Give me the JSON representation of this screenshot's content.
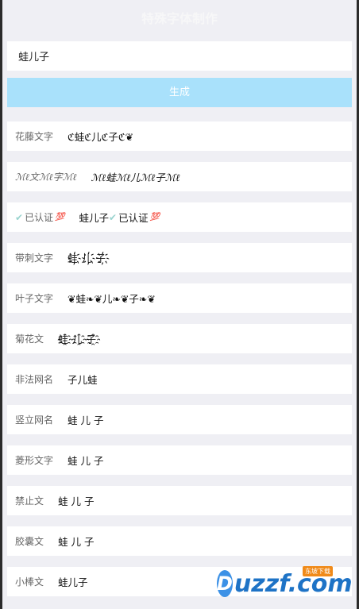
{
  "header": {
    "title": "特殊字体制作"
  },
  "input": {
    "value": "蛙儿子"
  },
  "generate_button": {
    "label": "生成"
  },
  "rows": [
    {
      "label": "花藤文字",
      "value": "ℭ蛙ℭ儿ℭ子ℭ❦"
    },
    {
      "label": "ℳℓ文ℳℓ字ℳℓ",
      "value": "ℳℓ蛙ℳℓ儿ℳℓ子ℳℓ"
    },
    {
      "label": "已认证",
      "badge": "💯",
      "value_name": "蛙儿子",
      "value_suffix": "已认证",
      "value_badge": "💯"
    },
    {
      "label": "带刺文字",
      "value": "蛙҉儿҉子҉"
    },
    {
      "label": "叶子文字",
      "value": "❦蛙❧❦儿❧❦子❧❦"
    },
    {
      "label": "菊花文",
      "value": "蛙҈儿҈子҈"
    },
    {
      "label": "非法网名",
      "value": "子儿蛙"
    },
    {
      "label": "竖立网名",
      "value": "蛙 儿 子"
    },
    {
      "label": "菱形文字",
      "value": "蛙 儿 子"
    },
    {
      "label": "禁止文",
      "value": "蛙 儿 子"
    },
    {
      "label": "胶囊文",
      "value": "蛙 儿 子"
    },
    {
      "label": "小棒文",
      "value": "蛙儿子"
    }
  ],
  "watermark": {
    "text": "uzzf.com",
    "tag": "东坡下载"
  }
}
